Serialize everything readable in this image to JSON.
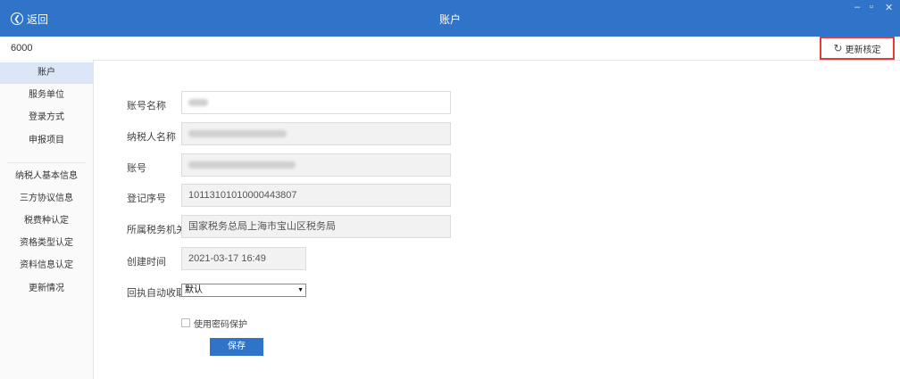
{
  "titlebar": {
    "back_label": "返回",
    "back_icon": "arrow-left-icon",
    "title": "账户",
    "minimize": "–",
    "restore": "▫",
    "close": "✕"
  },
  "subbar": {
    "account_id": "6000",
    "sync_label": "更新核定",
    "sync_icon": "refresh-icon"
  },
  "sidebar": {
    "items": [
      {
        "label": "账户",
        "active": true
      },
      {
        "label": "服务单位"
      },
      {
        "label": "登录方式"
      },
      {
        "label": "申报项目"
      },
      {
        "label": "纳税人基本信息"
      },
      {
        "label": "三方协议信息"
      },
      {
        "label": "税费种认定"
      },
      {
        "label": "资格类型认定"
      },
      {
        "label": "资料信息认定"
      },
      {
        "label": "更新情况"
      }
    ]
  },
  "form": {
    "account_name_label": "账号名称",
    "taxpayer_name_label": "纳税人名称",
    "account_no_label": "账号",
    "reg_no_label": "登记序号",
    "reg_no_value": "10113101010000443807",
    "tax_office_label": "所属税务机关",
    "tax_office_value": "国家税务总局上海市宝山区税务局",
    "created_label": "创建时间",
    "created_value": "2021-03-17 16:49",
    "receipt_label": "回执自动收取",
    "receipt_value": "默认",
    "password_label": "使用密码保护",
    "save_label": "保存"
  }
}
